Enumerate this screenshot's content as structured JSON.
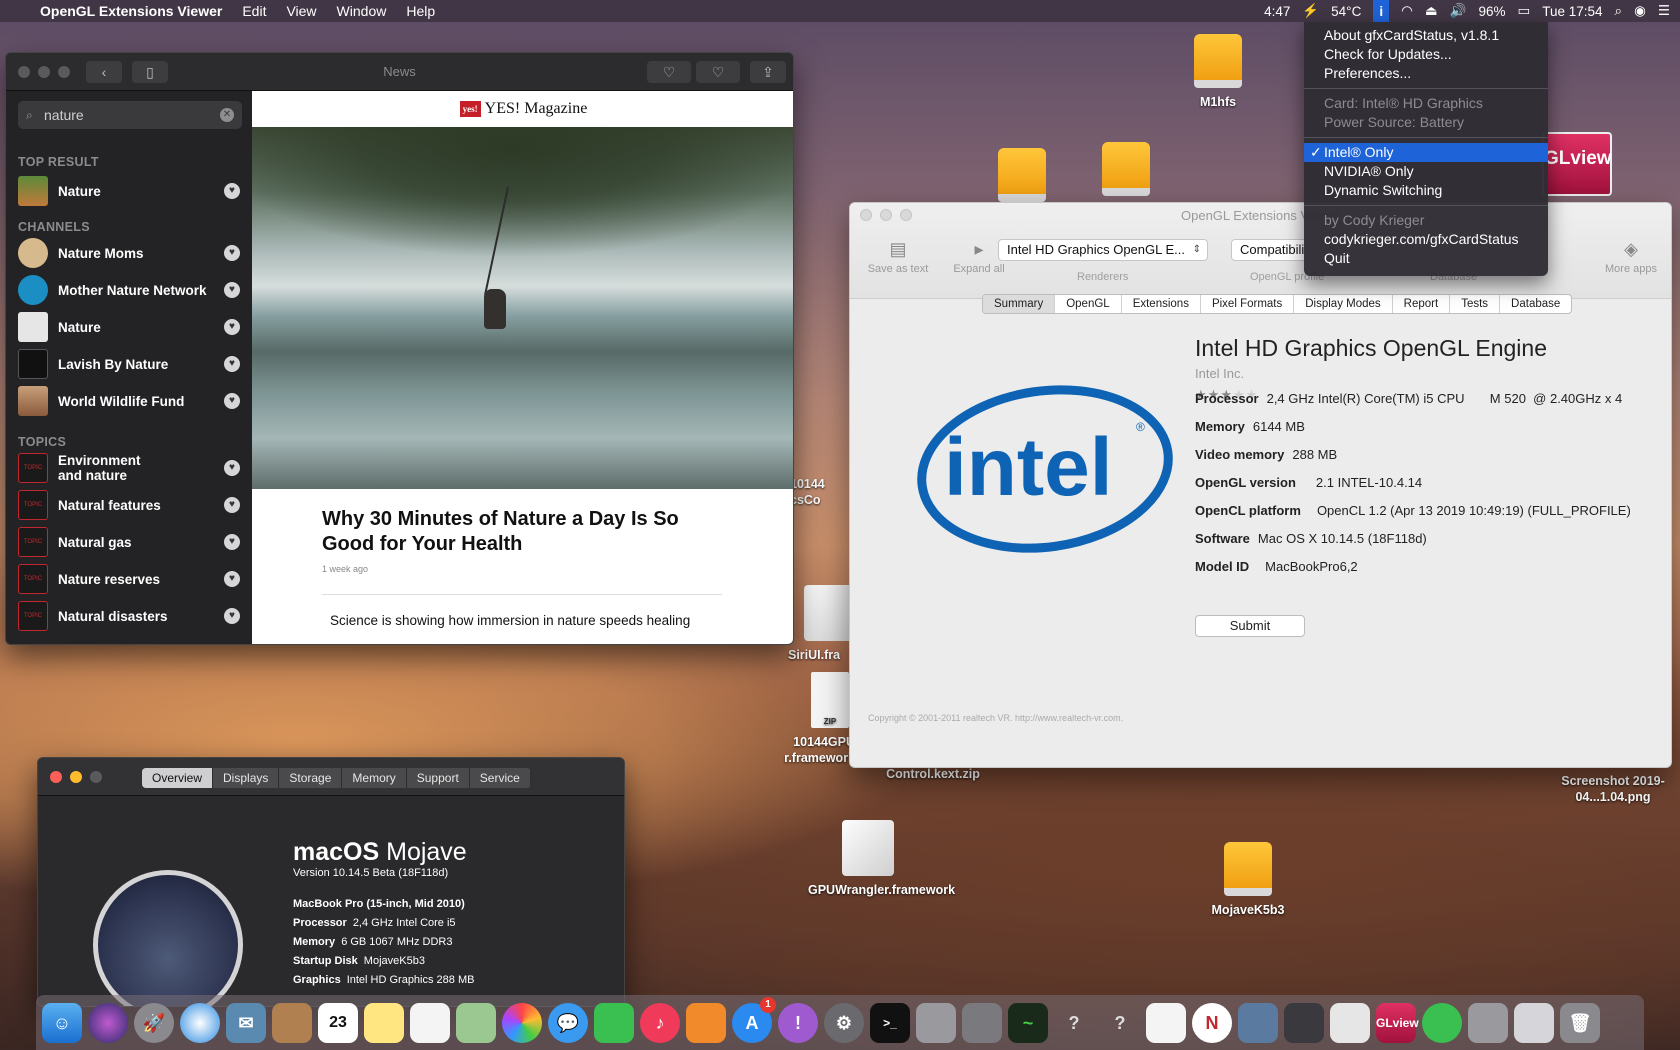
{
  "menubar": {
    "app_name": "OpenGL Extensions Viewer",
    "menus": [
      "Edit",
      "View",
      "Window",
      "Help"
    ],
    "status": {
      "time_left": "4:47",
      "temp": "54°C",
      "battery": "96%",
      "clock": "Tue 17:54"
    }
  },
  "gfx_menu": {
    "about": "About gfxCardStatus, v1.8.1",
    "updates": "Check for Updates...",
    "preferences": "Preferences...",
    "card": "Card: Intel® HD Graphics",
    "power": "Power Source: Battery",
    "intel_only": "Intel® Only",
    "nvidia_only": "NVIDIA® Only",
    "dynamic": "Dynamic Switching",
    "by": "by Cody Krieger",
    "site": "codykrieger.com/gfxCardStatus",
    "quit": "Quit"
  },
  "news": {
    "window_title": "News",
    "search_value": "nature",
    "sections": {
      "top": "TOP RESULT",
      "channels": "CHANNELS",
      "topics": "TOPICS"
    },
    "top_result": "Nature",
    "channels": [
      "Nature Moms",
      "Mother Nature Network",
      "Nature",
      "Lavish By Nature",
      "World Wildlife Fund"
    ],
    "topics": [
      "Environment and nature",
      "Natural features",
      "Natural gas",
      "Nature reserves",
      "Natural disasters"
    ],
    "topic_badge": "TOPIC",
    "publisher_badge": "yes!",
    "publisher": "YES! Magazine",
    "article_title": "Why 30 Minutes of Nature a Day Is So Good for Your Health",
    "article_date": "1 week ago",
    "article_excerpt": "Science is showing how immersion in nature speeds healing"
  },
  "ogl": {
    "window_title": "OpenGL Extensions Viewer",
    "tools": {
      "save": "Save as text",
      "expand": "Expand all",
      "more": "More apps"
    },
    "renderer": "Intel HD Graphics OpenGL E...",
    "profile": "Compatibili",
    "groups": {
      "renderers": "Renderers",
      "profile": "OpenGL profile",
      "database": "Database"
    },
    "tabs": [
      "Summary",
      "OpenGL",
      "Extensions",
      "Pixel Formats",
      "Display Modes",
      "Report",
      "Tests",
      "Database"
    ],
    "logo_text": "intel",
    "gpu_name": "Intel HD Graphics OpenGL Engine",
    "vendor": "Intel Inc.",
    "rating_stars": 3,
    "props": [
      {
        "k": "Processor",
        "v": "2,4 GHz Intel(R) Core(TM) i5 CPU       M 520  @ 2.40GHz x 4"
      },
      {
        "k": "Memory",
        "v": "6144 MB"
      },
      {
        "k": "Video memory",
        "v": "288 MB"
      },
      {
        "k": "OpenGL version",
        "v": "2.1 INTEL-10.4.14"
      },
      {
        "k": "OpenCL platform",
        "v": "OpenCL 1.2 (Apr 13 2019 10:49:19) (FULL_PROFILE)"
      },
      {
        "k": "Software",
        "v": "Mac OS X 10.14.5 (18F118d)"
      },
      {
        "k": "Model ID",
        "v": "MacBookPro6,2"
      }
    ],
    "submit": "Submit",
    "copyright": "Copyright © 2001-2011 realtech VR. http://www.realtech-vr.com."
  },
  "about": {
    "tabs": [
      "Overview",
      "Displays",
      "Storage",
      "Memory",
      "Support",
      "Service"
    ],
    "os_bold": "macOS",
    "os_name": "Mojave",
    "version": "Version 10.14.5 Beta (18F118d)",
    "model": "MacBook Pro (15-inch, Mid 2010)",
    "specs": [
      {
        "k": "Processor",
        "v": "2,4 GHz Intel Core i5"
      },
      {
        "k": "Memory",
        "v": "6 GB 1067 MHz DDR3"
      },
      {
        "k": "Startup Disk",
        "v": "MojaveK5b3"
      },
      {
        "k": "Graphics",
        "v": "Intel HD Graphics 288 MB"
      }
    ]
  },
  "desktop": {
    "m1hfs": "M1hfs",
    "partial1": "10144",
    "partial2": "csCo",
    "siriui": "SiriUI.fra",
    "zip1": "10144GPUW r.framework.zip",
    "zip_label": "ZIP",
    "control": "Control.kext.zip",
    "screenshot": "Screenshot 2019-04...1.04.png",
    "gpuwrangler": "GPUWrangler.framework",
    "mojave": "MojaveK5b3",
    "glview": "GLview"
  },
  "dock": {
    "calendar_day": "23",
    "appstore_badge": "1",
    "glview": "GLview"
  }
}
